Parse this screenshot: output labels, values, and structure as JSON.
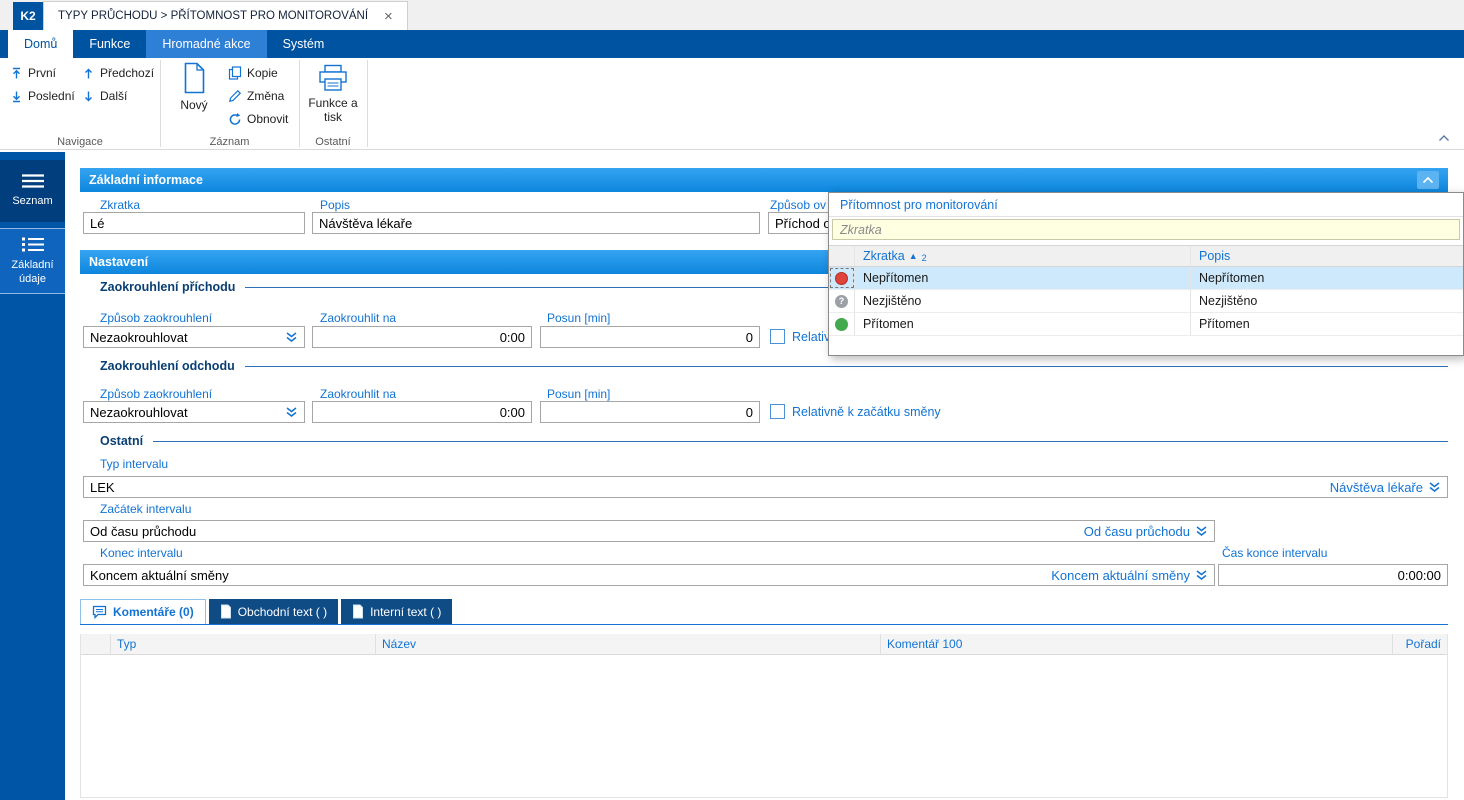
{
  "window": {
    "badge": "K2",
    "title": "TYPY PRŮCHODU > PŘÍTOMNOST PRO MONITOROVÁNÍ",
    "close": "×"
  },
  "ribbon": {
    "tabs": [
      {
        "label": "Domů",
        "state": "active"
      },
      {
        "label": "Funkce",
        "state": "normal"
      },
      {
        "label": "Hromadné akce",
        "state": "highlighted"
      },
      {
        "label": "Systém",
        "state": "normal"
      }
    ],
    "nav": {
      "first": "První",
      "last": "Poslední",
      "prev": "Předchozí",
      "next": "Další"
    },
    "record": {
      "new": "Nový",
      "copy": "Kopie",
      "change": "Změna",
      "refresh": "Obnovit"
    },
    "other": {
      "print": "Funkce a tisk"
    },
    "groups": {
      "nav": "Navigace",
      "record": "Záznam",
      "other": "Ostatní"
    }
  },
  "sidebar": {
    "items": [
      {
        "label": "Seznam"
      },
      {
        "label": "Základní údaje"
      }
    ]
  },
  "main": {
    "info_header": "Základní informace",
    "fields": {
      "zkratka": {
        "label": "Zkratka",
        "value": "Lé"
      },
      "popis": {
        "label": "Popis",
        "value": "Návštěva lékaře"
      },
      "zpusob": {
        "label": "Způsob ov",
        "value": "Příchod o"
      }
    },
    "nastaveni_header": "Nastavení",
    "rounding_in": {
      "title": "Zaokrouhlení příchodu",
      "way_label": "Způsob zaokrouhlení",
      "way_value": "Nezaokrouhlovat",
      "roundto_label": "Zaokrouhlit na",
      "roundto_value": "0:00",
      "shift_label": "Posun [min]",
      "shift_value": "0",
      "checkbox_label": "Relativně k začátku směny",
      "checkbox_checked": false
    },
    "rounding_out": {
      "title": "Zaokrouhlení odchodu",
      "way_label": "Způsob zaokrouhlení",
      "way_value": "Nezaokrouhlovat",
      "roundto_label": "Zaokrouhlit na",
      "roundto_value": "0:00",
      "shift_label": "Posun [min]",
      "shift_value": "0",
      "checkbox_label": "Relativně k začátku směny",
      "checkbox_checked": false
    },
    "ostatni_title": "Ostatní",
    "interval": {
      "typ_label": "Typ intervalu",
      "typ_value": "LEK",
      "typ_link": "Návštěva lékaře",
      "start_label": "Začátek intervalu",
      "start_value": "Od času průchodu",
      "start_link": "Od času průchodu",
      "end_label": "Konec intervalu",
      "end_value": "Koncem aktuální směny",
      "end_link": "Koncem aktuální směny",
      "endtime_label": "Čas konce intervalu",
      "endtime_value": "0:00:00"
    },
    "tabs": [
      {
        "label": "Komentáře (0)",
        "state": "active"
      },
      {
        "label": "Obchodní text ( )",
        "state": "normal"
      },
      {
        "label": "Interní text ( )",
        "state": "normal"
      }
    ]
  },
  "comments": {
    "columns": [
      "Typ",
      "Název",
      "Komentář 100",
      "Pořadí"
    ],
    "rows": []
  },
  "popup": {
    "title": "Přítomnost pro monitorování",
    "search_placeholder": "Zkratka",
    "columns": [
      {
        "label": "Zkratka",
        "sort": "▲",
        "sort_index": "2"
      },
      {
        "label": "Popis"
      }
    ],
    "rows": [
      {
        "icon": "status-red",
        "zkratka": "Nepřítomen",
        "popis": "Nepřítomen",
        "selected": true
      },
      {
        "icon": "status-question",
        "icon_glyph": "?",
        "zkratka": "Nezjištěno",
        "popis": "Nezjištěno",
        "selected": false
      },
      {
        "icon": "status-green",
        "zkratka": "Přítomen",
        "popis": "Přítomen",
        "selected": false
      }
    ]
  },
  "colors": {
    "ribbon_blue": "#0053a0",
    "ribbon_tab_highlight": "#2e7fd6",
    "section_header_blue": "#0f8ce2",
    "label_blue": "#1273d4",
    "selected_row": "#cde9fb",
    "status_red": "#e0433c",
    "status_gray": "#9aa0a6",
    "status_green": "#43a94d",
    "search_bg": "#ffffe1",
    "dark_tab": "#0f4c86",
    "sidebar_blue": "#0055a6"
  }
}
